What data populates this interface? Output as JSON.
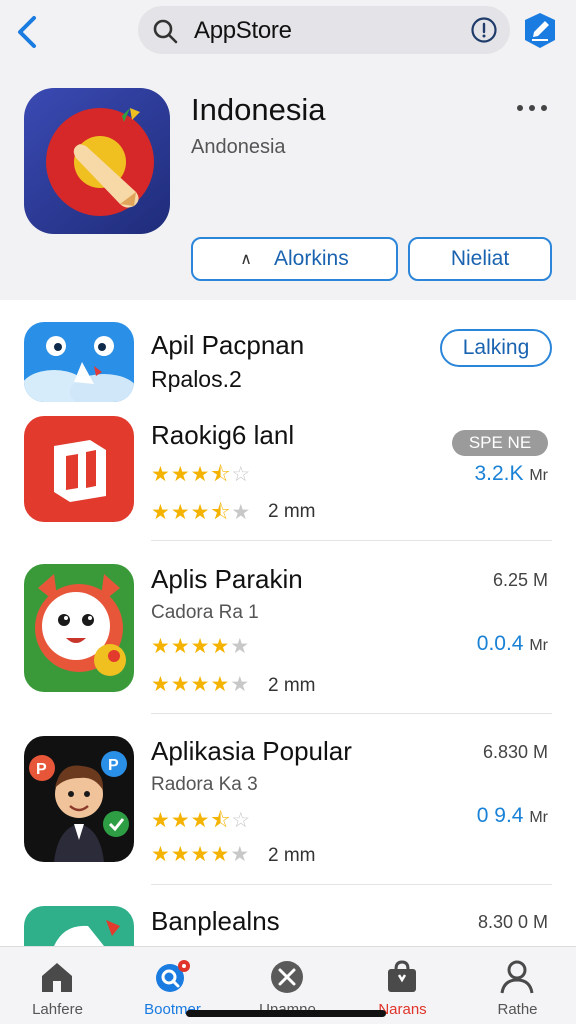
{
  "search": {
    "query": "AppStore"
  },
  "featured": {
    "title": "Indonesia",
    "subtitle": "Andonesia",
    "primary_button": "Alorkins",
    "secondary_button": "Nieliat"
  },
  "apps": [
    {
      "name": "Apil Pacpnan",
      "sub": "Rpalos.2",
      "button": "Lalking"
    },
    {
      "name": "Raokig6 lanl",
      "badge": "SPE NE",
      "price": "3.2.K",
      "price_unit": "Mr",
      "rating": 3.5,
      "rating2": 3.5,
      "downloads": "2 mm"
    },
    {
      "name": "Aplis Parakin",
      "sub": "Cadora Ra 1",
      "size": "6.25",
      "size_unit": "M",
      "price": "0.0.4",
      "price_unit": "Mr",
      "rating": 4,
      "rating2": 4,
      "downloads": "2 mm"
    },
    {
      "name": "Aplikasia Popular",
      "sub": "Radora Ka 3",
      "size": "6.830",
      "size_unit": "M",
      "price": "0 9.4",
      "price_unit": "Mr",
      "rating": 3.5,
      "rating2": 4,
      "downloads": "2 mm"
    },
    {
      "name": "Banplealns",
      "size": "8.30 0",
      "size_unit": "M"
    }
  ],
  "tabs": [
    {
      "label": "Lahfere",
      "icon": "home-icon"
    },
    {
      "label": "Bootmer",
      "icon": "search-badge-icon",
      "badge": true
    },
    {
      "label": "Unamno",
      "icon": "close-circle-icon"
    },
    {
      "label": "Narans",
      "icon": "bag-icon"
    },
    {
      "label": "Rathe",
      "icon": "person-icon"
    }
  ],
  "colors": {
    "accent": "#1a7be0",
    "star": "#f5b301",
    "tab_red": "#e0342a"
  }
}
